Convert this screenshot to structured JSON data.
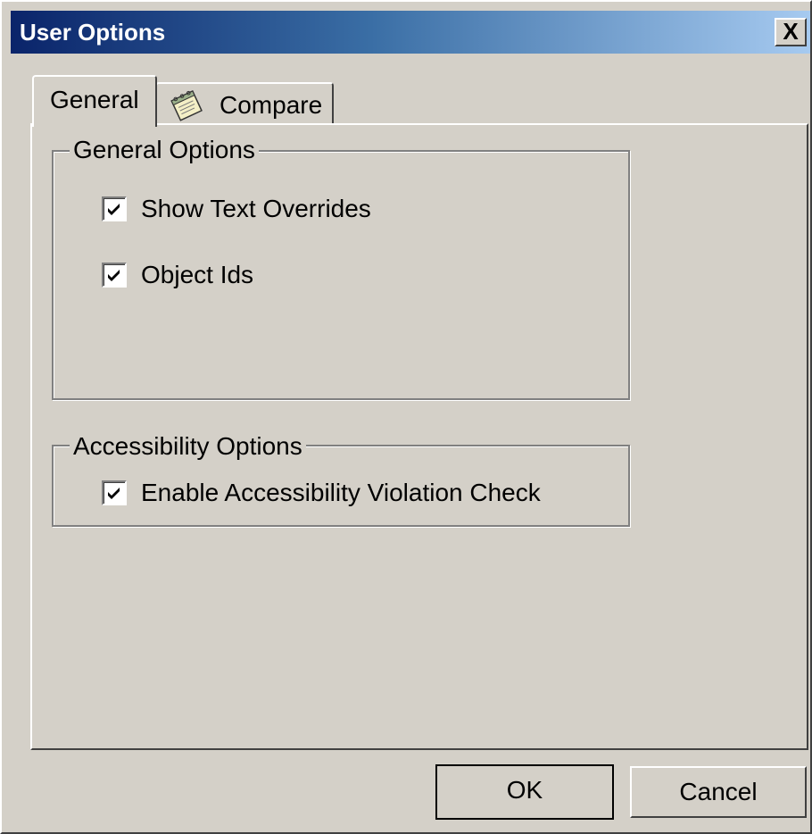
{
  "window": {
    "title": "User Options",
    "close_symbol": "X",
    "colors": {
      "titlebar_start": "#0a246a",
      "titlebar_end": "#a6caf0",
      "face": "#d4d0c8"
    }
  },
  "tabs": [
    {
      "label": "General",
      "selected": true
    },
    {
      "label": "Compare",
      "selected": false,
      "icon": "notepad-icon"
    }
  ],
  "general_options": {
    "legend": "General Options",
    "items": [
      {
        "label": "Show Text Overrides",
        "checked": true
      },
      {
        "label": "Object Ids",
        "checked": true
      }
    ]
  },
  "accessibility_options": {
    "legend": "Accessibility Options",
    "items": [
      {
        "label": "Enable Accessibility Violation Check",
        "checked": true
      }
    ]
  },
  "buttons": {
    "ok_label": "OK",
    "cancel_label": "Cancel"
  }
}
